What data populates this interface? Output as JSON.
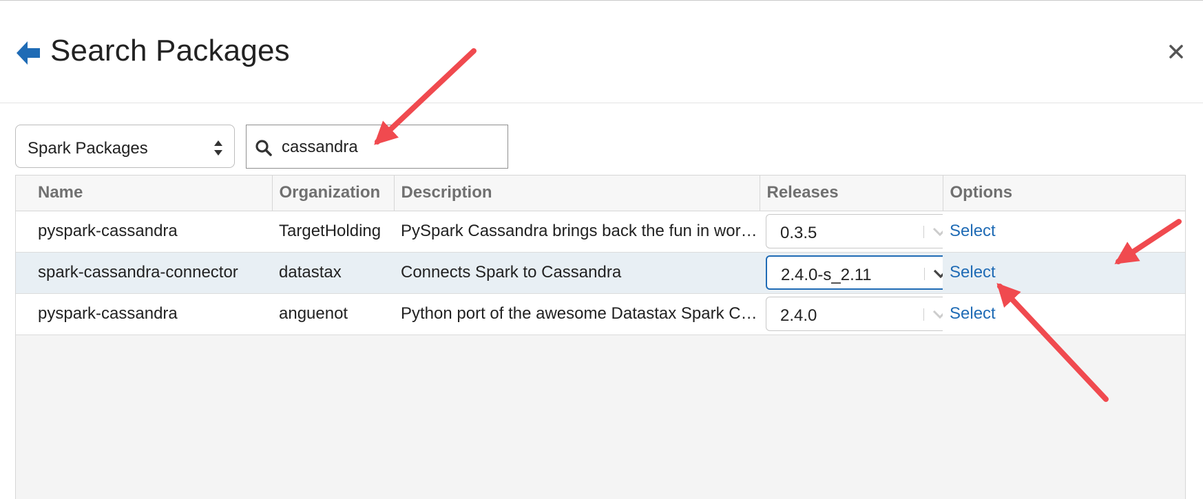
{
  "dialog": {
    "title": "Search Packages",
    "back_icon": "arrow-left-icon",
    "close_icon": "close-icon"
  },
  "source": {
    "selected": "Spark Packages",
    "icon": "up-down-caret-icon"
  },
  "search": {
    "value": "cassandra",
    "icon": "search-icon"
  },
  "table": {
    "columns": [
      "Name",
      "Organization",
      "Description",
      "Releases",
      "Options"
    ],
    "rows": [
      {
        "name": "pyspark-cassandra",
        "organization": "TargetHolding",
        "description": "PySpark Cassandra brings back the fun in wor…",
        "release": "0.3.5",
        "option": "Select"
      },
      {
        "name": "spark-cassandra-connector",
        "organization": "datastax",
        "description": "Connects Spark to Cassandra",
        "release": "2.4.0-s_2.11",
        "option": "Select"
      },
      {
        "name": "pyspark-cassandra",
        "organization": "anguenot",
        "description": "Python port of the awesome Datastax Spark C…",
        "release": "2.4.0",
        "option": "Select"
      }
    ]
  },
  "colors": {
    "accent": "#1f6bb5",
    "annotation_arrow": "#f04a4f",
    "selected_row": "#e8eff4"
  }
}
